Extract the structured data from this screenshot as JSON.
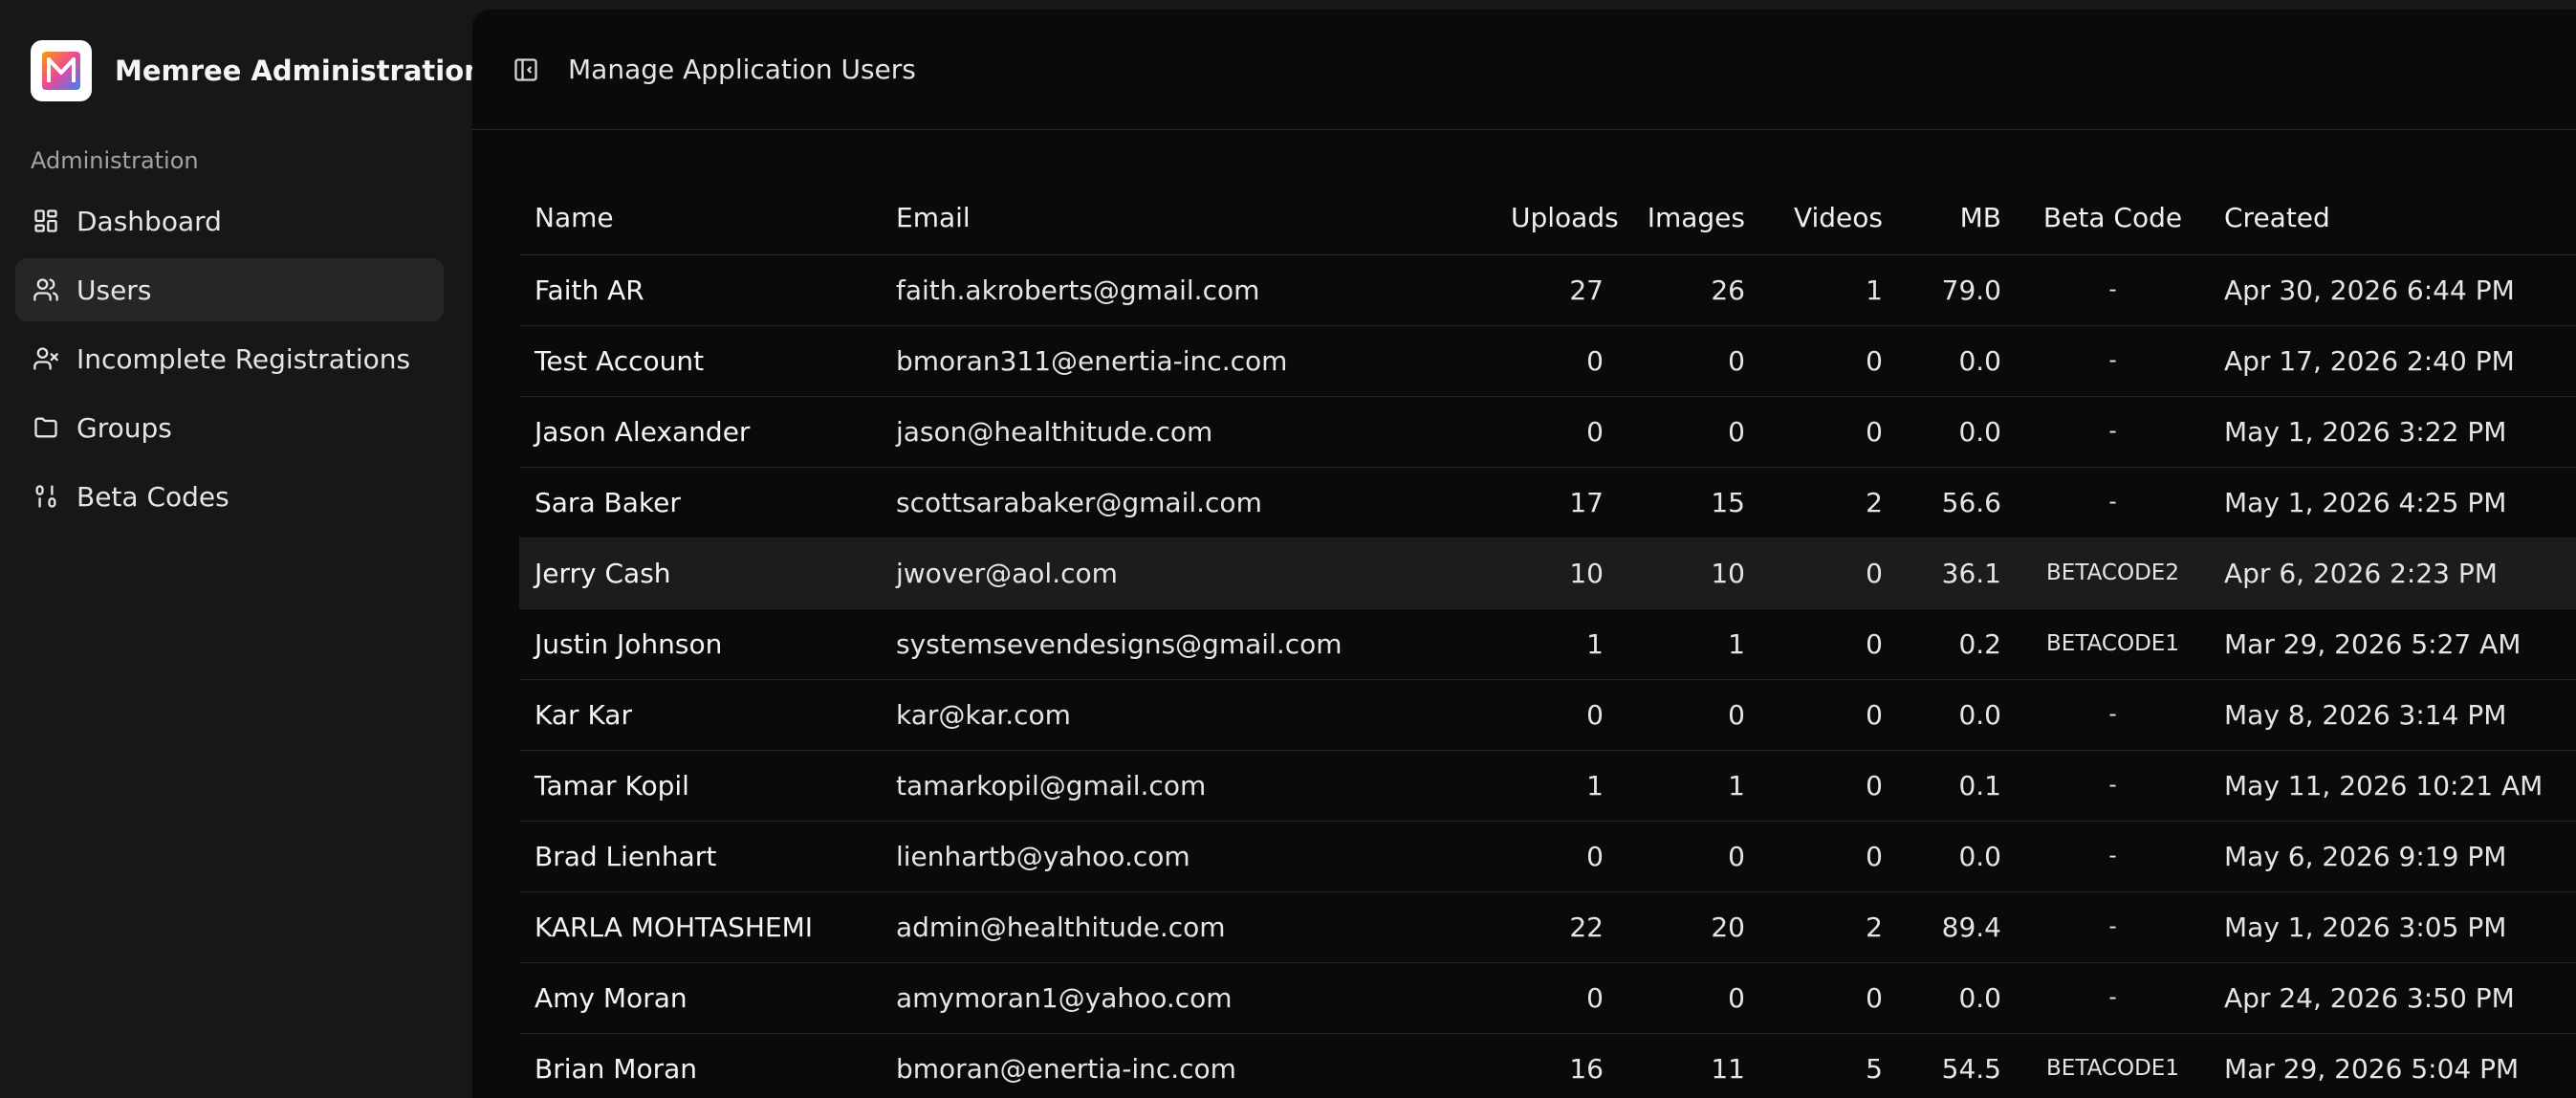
{
  "app": {
    "title": "Memree Administration"
  },
  "sidebar": {
    "section_label": "Administration",
    "items": [
      {
        "label": "Dashboard",
        "icon": "dashboard-icon"
      },
      {
        "label": "Users",
        "icon": "users-icon",
        "active": true
      },
      {
        "label": "Incomplete Registrations",
        "icon": "user-x-icon"
      },
      {
        "label": "Groups",
        "icon": "folder-icon"
      },
      {
        "label": "Beta Codes",
        "icon": "beta-codes-icon"
      }
    ]
  },
  "header": {
    "title": "Manage Application Users"
  },
  "table": {
    "columns": [
      "Name",
      "Email",
      "Uploads",
      "Images",
      "Videos",
      "MB",
      "Beta Code",
      "Created"
    ],
    "rows": [
      {
        "name": "Faith AR",
        "email": "faith.akroberts@gmail.com",
        "uploads": "27",
        "images": "26",
        "videos": "1",
        "mb": "79.0",
        "beta": "-",
        "created": "Apr 30, 2026 6:44 PM"
      },
      {
        "name": "Test Account",
        "email": "bmoran311@enertia-inc.com",
        "uploads": "0",
        "images": "0",
        "videos": "0",
        "mb": "0.0",
        "beta": "-",
        "created": "Apr 17, 2026 2:40 PM"
      },
      {
        "name": "Jason Alexander",
        "email": "jason@healthitude.com",
        "uploads": "0",
        "images": "0",
        "videos": "0",
        "mb": "0.0",
        "beta": "-",
        "created": "May 1, 2026 3:22 PM"
      },
      {
        "name": "Sara Baker",
        "email": "scottsarabaker@gmail.com",
        "uploads": "17",
        "images": "15",
        "videos": "2",
        "mb": "56.6",
        "beta": "-",
        "created": "May 1, 2026 4:25 PM"
      },
      {
        "name": "Jerry Cash",
        "email": "jwover@aol.com",
        "uploads": "10",
        "images": "10",
        "videos": "0",
        "mb": "36.1",
        "beta": "BETACODE2",
        "created": "Apr 6, 2026 2:23 PM"
      },
      {
        "name": "Justin Johnson",
        "email": "systemsevendesigns@gmail.com",
        "uploads": "1",
        "images": "1",
        "videos": "0",
        "mb": "0.2",
        "beta": "BETACODE1",
        "created": "Mar 29, 2026 5:27 AM"
      },
      {
        "name": "Kar Kar",
        "email": "kar@kar.com",
        "uploads": "0",
        "images": "0",
        "videos": "0",
        "mb": "0.0",
        "beta": "-",
        "created": "May 8, 2026 3:14 PM"
      },
      {
        "name": "Tamar Kopil",
        "email": "tamarkopil@gmail.com",
        "uploads": "1",
        "images": "1",
        "videos": "0",
        "mb": "0.1",
        "beta": "-",
        "created": "May 11, 2026 10:21 AM"
      },
      {
        "name": "Brad Lienhart",
        "email": "lienhartb@yahoo.com",
        "uploads": "0",
        "images": "0",
        "videos": "0",
        "mb": "0.0",
        "beta": "-",
        "created": "May 6, 2026 9:19 PM"
      },
      {
        "name": "KARLA MOHTASHEMI",
        "email": "admin@healthitude.com",
        "uploads": "22",
        "images": "20",
        "videos": "2",
        "mb": "89.4",
        "beta": "-",
        "created": "May 1, 2026 3:05 PM"
      },
      {
        "name": "Amy Moran",
        "email": "amymoran1@yahoo.com",
        "uploads": "0",
        "images": "0",
        "videos": "0",
        "mb": "0.0",
        "beta": "-",
        "created": "Apr 24, 2026 3:50 PM"
      },
      {
        "name": "Brian Moran",
        "email": "bmoran@enertia-inc.com",
        "uploads": "16",
        "images": "11",
        "videos": "5",
        "mb": "54.5",
        "beta": "BETACODE1",
        "created": "Mar 29, 2026 5:04 PM"
      }
    ]
  },
  "colors": {
    "sidebar_bg": "#171717",
    "main_bg": "#0a0a0a",
    "active_item_bg": "#262626",
    "hover_row_bg": "#1c1c1c"
  }
}
